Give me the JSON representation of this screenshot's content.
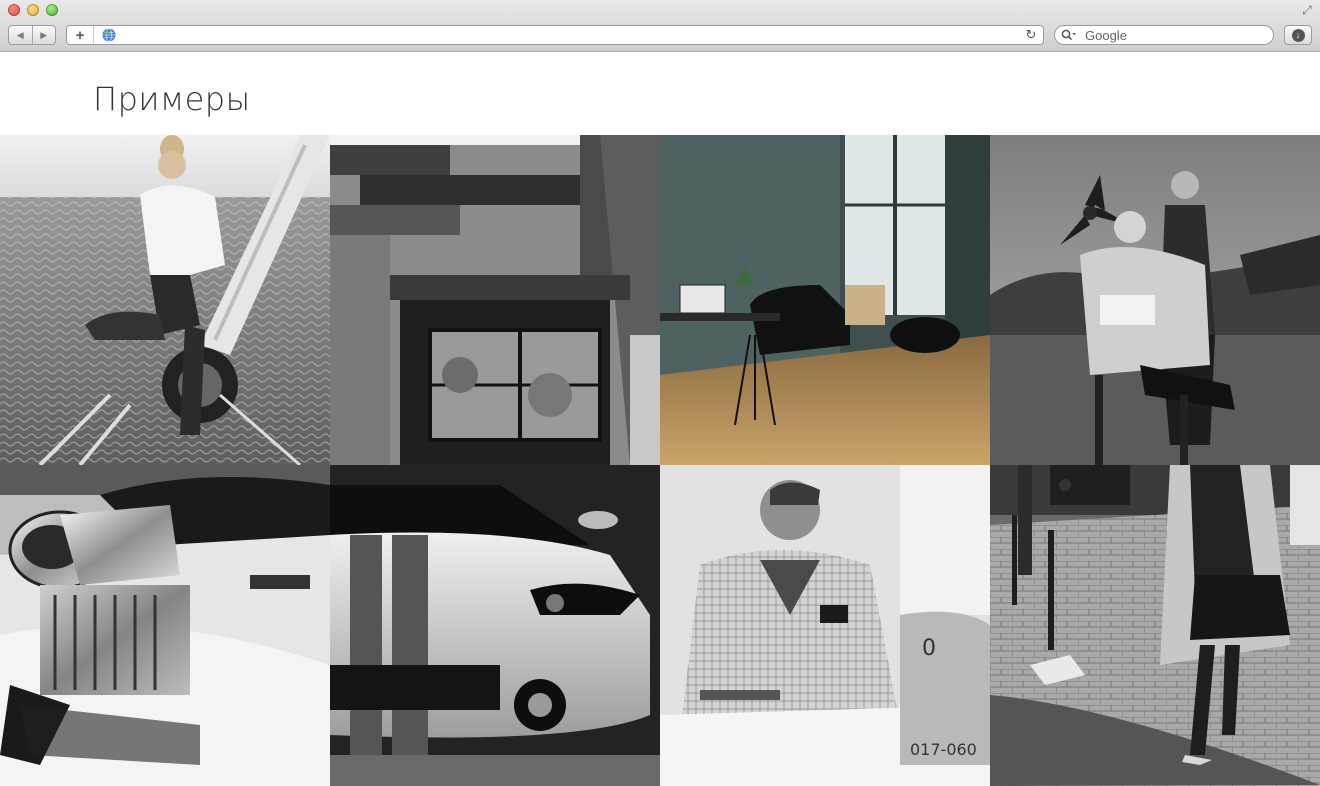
{
  "browser": {
    "search": {
      "placeholder": "Google"
    }
  },
  "page": {
    "title": "Примеры"
  },
  "gallery": {
    "photos": [
      {
        "name": "photo-woman-sailboat"
      },
      {
        "name": "photo-modern-house"
      },
      {
        "name": "photo-loft-interior"
      },
      {
        "name": "photo-barber-airplane"
      },
      {
        "name": "photo-engine-supercharger"
      },
      {
        "name": "photo-sports-car"
      },
      {
        "name": "photo-man-reading"
      },
      {
        "name": "photo-woman-street"
      }
    ]
  },
  "colors": {
    "heading": "#333333",
    "chrome_top": "#e9e9e9",
    "chrome_bottom": "#cfcfcf"
  }
}
